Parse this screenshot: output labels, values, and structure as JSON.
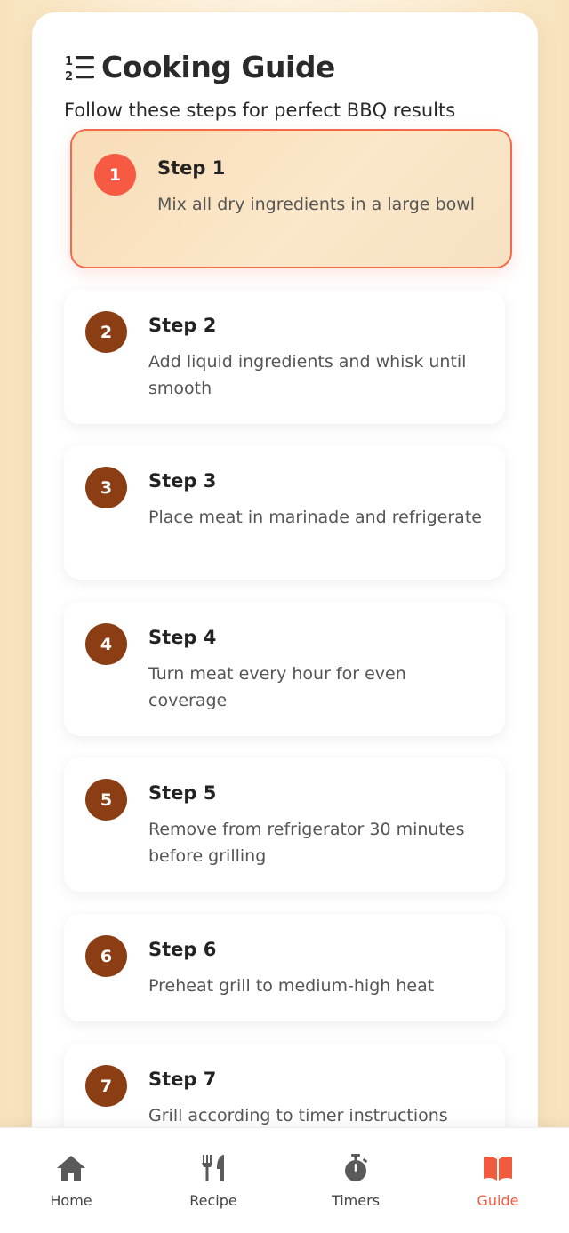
{
  "header": {
    "title": "Cooking Guide",
    "subtitle": "Follow these steps for perfect BBQ results",
    "icon": "numbered-list-icon"
  },
  "steps": [
    {
      "number": "1",
      "title": "Step 1",
      "text": "Mix all dry ingredients in a large bowl",
      "active": true
    },
    {
      "number": "2",
      "title": "Step 2",
      "text": "Add liquid ingredients and whisk until smooth",
      "active": false
    },
    {
      "number": "3",
      "title": "Step 3",
      "text": "Place meat in marinade and refrigerate",
      "active": false
    },
    {
      "number": "4",
      "title": "Step 4",
      "text": "Turn meat every hour for even coverage",
      "active": false
    },
    {
      "number": "5",
      "title": "Step 5",
      "text": "Remove from refrigerator 30 minutes before grilling",
      "active": false
    },
    {
      "number": "6",
      "title": "Step 6",
      "text": "Preheat grill to medium-high heat",
      "active": false
    },
    {
      "number": "7",
      "title": "Step 7",
      "text": "Grill according to timer instructions",
      "active": false
    }
  ],
  "nav": {
    "items": [
      {
        "label": "Home",
        "icon": "home-icon",
        "active": false
      },
      {
        "label": "Recipe",
        "icon": "utensils-icon",
        "active": false
      },
      {
        "label": "Timers",
        "icon": "stopwatch-icon",
        "active": false
      },
      {
        "label": "Guide",
        "icon": "book-icon",
        "active": true
      }
    ]
  },
  "colors": {
    "accent": "#f65a43",
    "badge": "#8b3e14",
    "active_nav": "#f15a3c",
    "icon_gray": "#5a5a5a"
  }
}
